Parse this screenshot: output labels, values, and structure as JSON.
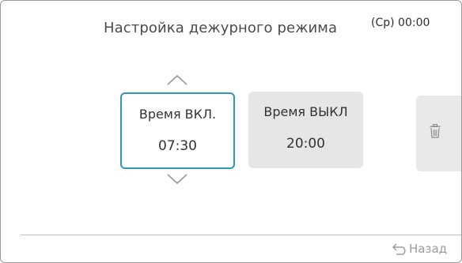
{
  "header": {
    "title": "Настройка дежурного режима",
    "clock": "(Ср) 00:00"
  },
  "schedule": {
    "on": {
      "label": "Время ВКЛ.",
      "value": "07:30",
      "selected": true
    },
    "off": {
      "label": "Время ВЫКЛ",
      "value": "20:00",
      "selected": false
    }
  },
  "icons": {
    "increment": "chevron-up-icon",
    "decrement": "chevron-down-icon",
    "delete": "trash-icon",
    "back": "back-arrow-icon"
  },
  "footer": {
    "back_label": "Назад"
  },
  "colors": {
    "selected_border": "#3296b8",
    "tile_bg": "#e6e6e6",
    "muted_text": "#9b9b9b"
  }
}
